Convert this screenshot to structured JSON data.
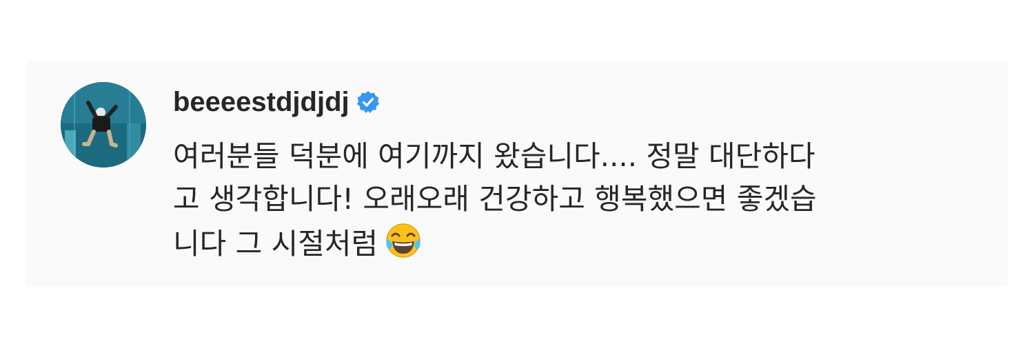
{
  "comment": {
    "username": "beeeestdjdjdj",
    "verified": true,
    "lines": [
      "여러분들 덕분에 여기까지 왔습니다.... 정말 대단하다",
      "고 생각합니다! 오래오래 건강하고 행복했으면 좋겠습",
      "니다 그 시절처럼"
    ],
    "emoji": "face-with-tears-of-joy",
    "colors": {
      "text": "#262626",
      "verified_badge": "#3797f0",
      "background": "#fafafa"
    }
  }
}
